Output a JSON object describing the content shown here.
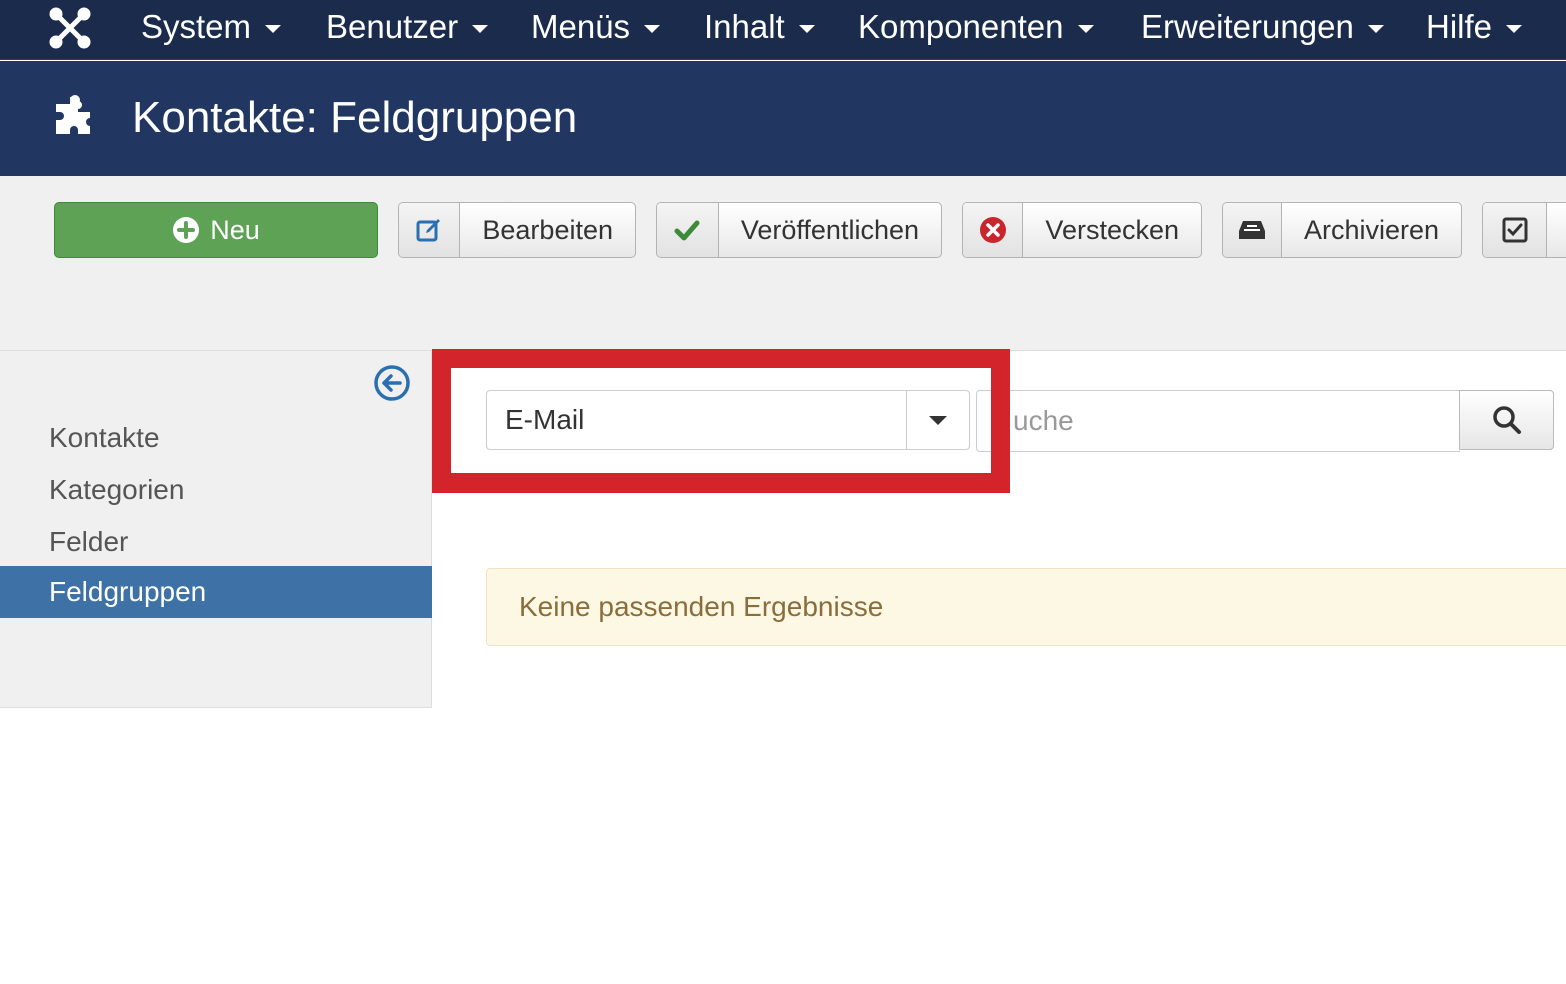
{
  "navbar": {
    "items": [
      {
        "label": "System"
      },
      {
        "label": "Benutzer"
      },
      {
        "label": "Menüs"
      },
      {
        "label": "Inhalt"
      },
      {
        "label": "Komponenten"
      },
      {
        "label": "Erweiterungen"
      },
      {
        "label": "Hilfe"
      }
    ]
  },
  "header": {
    "title": "Kontakte: Feldgruppen",
    "icon": "puzzle-icon"
  },
  "toolbar": {
    "new_label": "Neu",
    "edit_label": "Bearbeiten",
    "publish_label": "Veröffentlichen",
    "unpublish_label": "Verstecken",
    "archive_label": "Archivieren"
  },
  "sidebar": {
    "items": [
      {
        "label": "Kontakte"
      },
      {
        "label": "Kategorien"
      },
      {
        "label": "Felder"
      },
      {
        "label": "Feldgruppen",
        "active": true
      }
    ]
  },
  "filter": {
    "context_value": "E-Mail",
    "search_placeholder": "uche"
  },
  "alert": {
    "message": "Keine passenden Ergebnisse"
  },
  "colors": {
    "navbar": "#1a2b4c",
    "header": "#213761",
    "new_button": "#5ea255",
    "active_sidebar": "#3e71a5",
    "highlight": "#d2242a",
    "alert_bg": "#fcf8e3"
  }
}
